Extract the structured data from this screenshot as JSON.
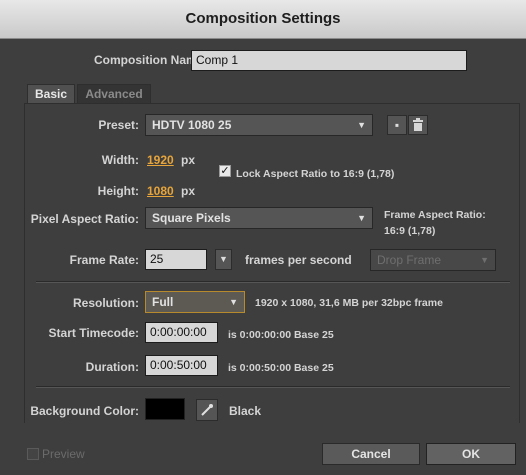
{
  "window": {
    "title": "Composition Settings"
  },
  "name": {
    "label": "Composition Name:",
    "value": "Comp 1"
  },
  "tabs": [
    {
      "label": "Basic"
    },
    {
      "label": "Advanced"
    }
  ],
  "preset": {
    "label": "Preset:",
    "value": "HDTV 1080 25",
    "save_icon": "save-icon",
    "delete_icon": "trash-icon"
  },
  "width": {
    "label": "Width:",
    "value": "1920",
    "unit": "px"
  },
  "height": {
    "label": "Height:",
    "value": "1080",
    "unit": "px"
  },
  "lock": {
    "label": "Lock Aspect Ratio to 16:9 (1,78)",
    "checked": true
  },
  "pixel_aspect": {
    "label": "Pixel Aspect Ratio:",
    "value": "Square Pixels"
  },
  "frame_aspect": {
    "label": "Frame Aspect Ratio:",
    "value": "16:9 (1,78)"
  },
  "frame_rate": {
    "label": "Frame Rate:",
    "value": "25",
    "suffix": "frames per second",
    "drop_frame": "Drop Frame"
  },
  "resolution": {
    "label": "Resolution:",
    "value": "Full",
    "info": "1920 x 1080, 31,6 MB per 32bpc frame"
  },
  "start_timecode": {
    "label": "Start Timecode:",
    "value": "0:00:00:00",
    "info": "is 0:00:00:00  Base 25"
  },
  "duration": {
    "label": "Duration:",
    "value": "0:00:50:00",
    "info": "is 0:00:50:00  Base 25"
  },
  "background": {
    "label": "Background Color:",
    "color": "#000000",
    "color_name": "Black",
    "eyedropper_icon": "eyedropper-icon"
  },
  "footer": {
    "preview_label": "Preview",
    "cancel_label": "Cancel",
    "ok_label": "OK"
  },
  "colors": {
    "accent": "#e6a43a",
    "panel": "#3e3e3e"
  }
}
